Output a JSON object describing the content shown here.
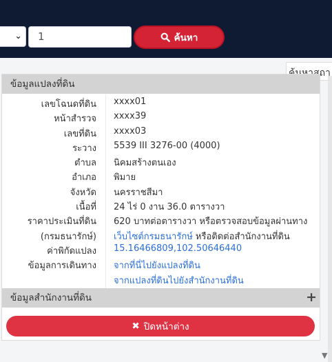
{
  "search": {
    "number_value": "1",
    "button_label": "ค้นหา"
  },
  "map": {
    "search_place_label": "ค้นหาสถา"
  },
  "popup": {
    "section1_title": "ข้อมูลแปลงที่ดิน",
    "section2_title": "ข้อมูลสำนักงานที่ดิน",
    "rows": [
      {
        "label": "เลขโฉนดที่ดิน",
        "value": "xxxx01"
      },
      {
        "label": "หน้าสำรวจ",
        "value": "xxxx39"
      },
      {
        "label": "เลขที่ดิน",
        "value": "xxxx03"
      },
      {
        "label": "ระวาง",
        "value": "5539 III 3276-00 (4000)"
      },
      {
        "label": "ตำบล",
        "value": "นิคมสร้างตนเอง"
      },
      {
        "label": "อำเภอ",
        "value": "พิมาย"
      },
      {
        "label": "จังหวัด",
        "value": "นครราชสีมา"
      },
      {
        "label": "เนื้อที่",
        "value": "24 ไร่ 0 งาน 36.0 ตารางวา"
      },
      {
        "label": "ราคาประเมินที่ดิน",
        "value": "620 บาทต่อตารางวา หรือตรวจสอบข้อมูลผ่านทาง"
      },
      {
        "label": "(กรมธนารักษ์)",
        "link": "เว็บไซต์กรมธนารักษ์",
        "value_suffix": " หรือติดต่อสำนักงานที่ดิน"
      },
      {
        "label": "ค่าพิกัดแปลง",
        "link": "15.16466809,102.50646440"
      },
      {
        "label": "ข้อมูลการเดินทาง",
        "link": "จากที่นี่ไปยังแปลงที่ดิน"
      },
      {
        "label": "",
        "link": "จากแปลงที่ดินไปยังสำนักงานที่ดิน"
      }
    ],
    "close_label": "ปิดหน้าต่าง"
  },
  "colors": {
    "topbar": "#0f1a33",
    "search_button": "#d42335",
    "close_button": "#df3344",
    "link": "#2a6fdb",
    "section_header": "#d3d3d3"
  }
}
